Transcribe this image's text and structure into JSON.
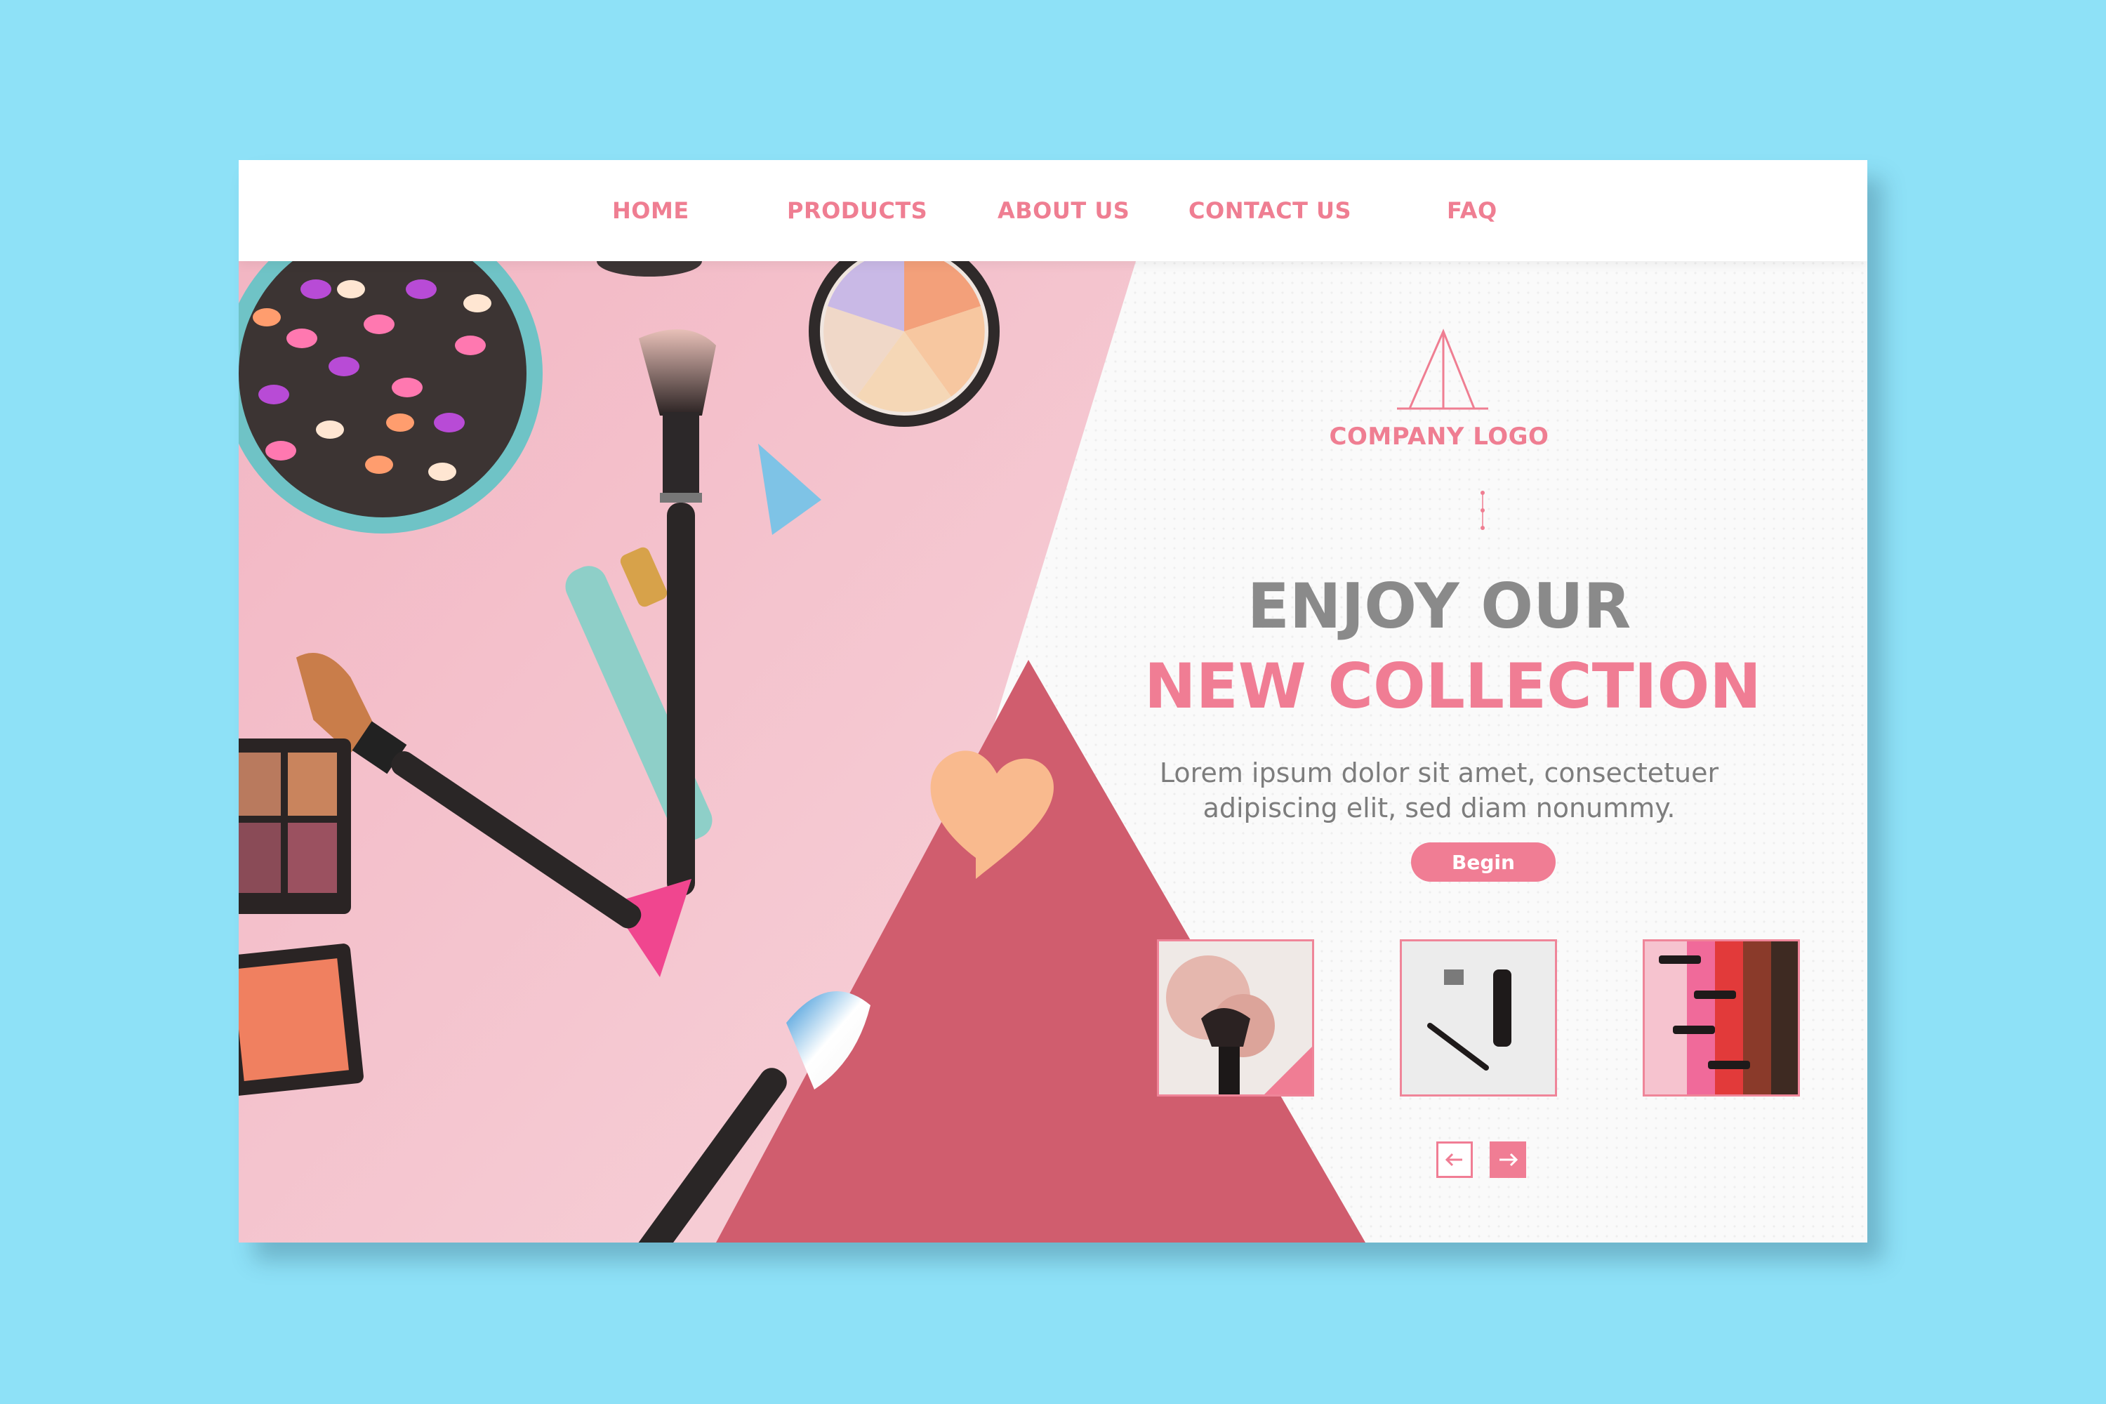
{
  "nav": {
    "items": [
      {
        "label": "HOME"
      },
      {
        "label": "PRODUCTS"
      },
      {
        "label": "ABOUT US"
      },
      {
        "label": "CONTACT US"
      },
      {
        "label": "FAQ"
      }
    ]
  },
  "brand": {
    "logo_text": "COMPANY LOGO"
  },
  "hero": {
    "heading_line1": "ENJOY OUR",
    "heading_line2": "NEW COLLECTION",
    "body_line1": "Lorem ipsum dolor sit amet, consectetuer",
    "body_line2": "adipiscing elit, sed diam nonummy.",
    "cta_label": "Begin"
  },
  "gallery": {
    "thumbnails": [
      {
        "icon": "blush-brush-photo"
      },
      {
        "icon": "mascara-photo"
      },
      {
        "icon": "lipsticks-photo"
      }
    ],
    "prev_icon": "arrow-left-icon",
    "next_icon": "arrow-right-icon"
  },
  "colors": {
    "background": "#8ee1f7",
    "accent_pink": "#f07d94",
    "deep_rose": "#d05d6e",
    "soft_pink": "#f5c3cd",
    "heading_gray": "#8a8a8a"
  }
}
